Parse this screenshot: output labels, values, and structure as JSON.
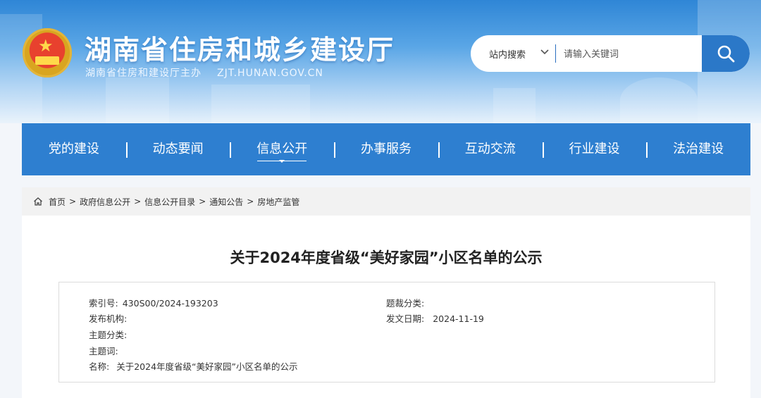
{
  "site": {
    "title": "湖南省住房和城乡建设厅",
    "subtitle": "湖南省住房和建设厅主办",
    "domain": "ZJT.HUNAN.GOV.CN"
  },
  "search": {
    "scope": "站内搜索",
    "placeholder": "请输入关键词"
  },
  "nav": {
    "items": [
      {
        "label": "党的建设"
      },
      {
        "label": "动态要闻"
      },
      {
        "label": "信息公开"
      },
      {
        "label": "办事服务"
      },
      {
        "label": "互动交流"
      },
      {
        "label": "行业建设"
      },
      {
        "label": "法治建设"
      }
    ]
  },
  "breadcrumb": [
    "首页",
    "政府信息公开",
    "信息公开目录",
    "通知公告",
    "房地产监管"
  ],
  "article": {
    "title": "关于2024年度省级“美好家园”小区名单的公示",
    "index_label": "索引号:",
    "index_value": "430S00/2024-193203",
    "genre_label": "题裁分类:",
    "publisher_label": "发布机构:",
    "date_label": "发文日期:",
    "date_value": "2024-11-19",
    "topic_label": "主题分类:",
    "keyword_label": "主题词:",
    "name_label": "名称:",
    "name_value": "关于2024年度省级“美好家园”小区名单的公示"
  },
  "colors": {
    "header_blue": "#2f86d6",
    "nav_blue": "#2e7fd0",
    "search_button": "#2b78c8"
  }
}
